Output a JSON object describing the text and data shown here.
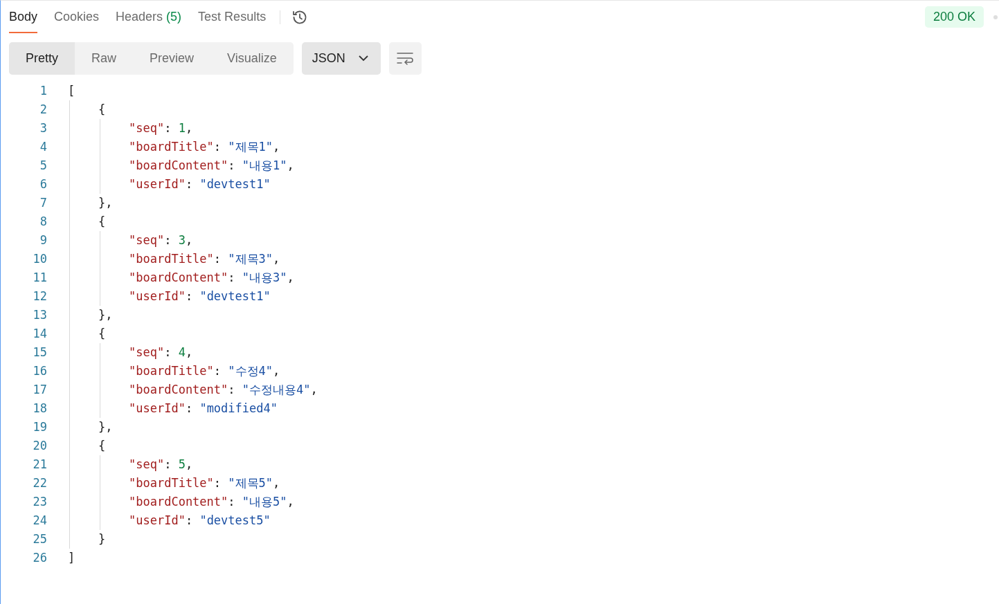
{
  "tabs": [
    {
      "label": "Body",
      "selected": true
    },
    {
      "label": "Cookies",
      "selected": false
    },
    {
      "label": "Headers",
      "count": "(5)",
      "selected": false
    },
    {
      "label": "Test Results",
      "selected": false
    }
  ],
  "status": "200 OK",
  "view_modes": [
    {
      "label": "Pretty",
      "selected": true
    },
    {
      "label": "Raw",
      "selected": false
    },
    {
      "label": "Preview",
      "selected": false
    },
    {
      "label": "Visualize",
      "selected": false
    }
  ],
  "format": "JSON",
  "code": {
    "open": "[",
    "close": "]",
    "objects": [
      {
        "open": "{",
        "close": "},",
        "fields": [
          {
            "key": "\"seq\"",
            "colon": ":",
            "value": "1",
            "kind": "number",
            "comma": ","
          },
          {
            "key": "\"boardTitle\"",
            "colon": ":",
            "value": "\"제목1\"",
            "kind": "string",
            "comma": ","
          },
          {
            "key": "\"boardContent\"",
            "colon": ":",
            "value": "\"내용1\"",
            "kind": "string",
            "comma": ","
          },
          {
            "key": "\"userId\"",
            "colon": ":",
            "value": "\"devtest1\"",
            "kind": "string"
          }
        ]
      },
      {
        "open": "{",
        "close": "},",
        "fields": [
          {
            "key": "\"seq\"",
            "colon": ":",
            "value": "3",
            "kind": "number",
            "comma": ","
          },
          {
            "key": "\"boardTitle\"",
            "colon": ":",
            "value": "\"제목3\"",
            "kind": "string",
            "comma": ","
          },
          {
            "key": "\"boardContent\"",
            "colon": ":",
            "value": "\"내용3\"",
            "kind": "string",
            "comma": ","
          },
          {
            "key": "\"userId\"",
            "colon": ":",
            "value": "\"devtest1\"",
            "kind": "string"
          }
        ]
      },
      {
        "open": "{",
        "close": "},",
        "fields": [
          {
            "key": "\"seq\"",
            "colon": ":",
            "value": "4",
            "kind": "number",
            "comma": ","
          },
          {
            "key": "\"boardTitle\"",
            "colon": ":",
            "value": "\"수정4\"",
            "kind": "string",
            "comma": ","
          },
          {
            "key": "\"boardContent\"",
            "colon": ":",
            "value": "\"수정내용4\"",
            "kind": "string",
            "comma": ","
          },
          {
            "key": "\"userId\"",
            "colon": ":",
            "value": "\"modified4\"",
            "kind": "string"
          }
        ]
      },
      {
        "open": "{",
        "close": "}",
        "fields": [
          {
            "key": "\"seq\"",
            "colon": ":",
            "value": "5",
            "kind": "number",
            "comma": ","
          },
          {
            "key": "\"boardTitle\"",
            "colon": ":",
            "value": "\"제목5\"",
            "kind": "string",
            "comma": ","
          },
          {
            "key": "\"boardContent\"",
            "colon": ":",
            "value": "\"내용5\"",
            "kind": "string",
            "comma": ","
          },
          {
            "key": "\"userId\"",
            "colon": ":",
            "value": "\"devtest5\"",
            "kind": "string"
          }
        ]
      }
    ]
  },
  "line_numbers": [
    "1",
    "2",
    "3",
    "4",
    "5",
    "6",
    "7",
    "8",
    "9",
    "10",
    "11",
    "12",
    "13",
    "14",
    "15",
    "16",
    "17",
    "18",
    "19",
    "20",
    "21",
    "22",
    "23",
    "24",
    "25",
    "26"
  ]
}
